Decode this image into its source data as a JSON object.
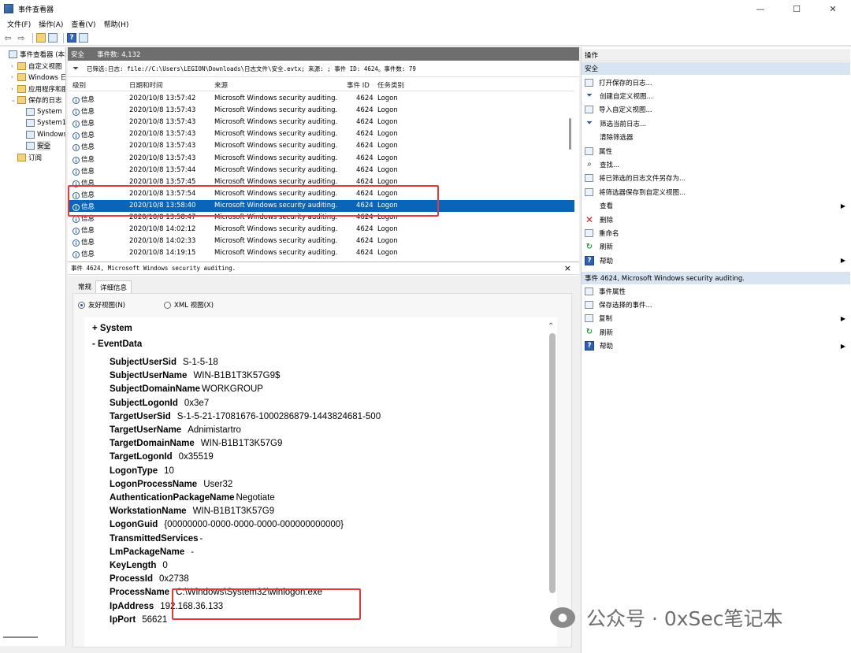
{
  "window": {
    "title": "事件查看器",
    "controls": [
      "—",
      "☐",
      "✕"
    ]
  },
  "menu": [
    "文件(F)",
    "操作(A)",
    "查看(V)",
    "帮助(H)"
  ],
  "tree": [
    {
      "label": "事件查看器 (本地)",
      "indent": 0,
      "exp": "",
      "icon": "event-viewer"
    },
    {
      "label": "自定义视图",
      "indent": 1,
      "exp": "›",
      "icon": "folder"
    },
    {
      "label": "Windows 日志",
      "indent": 1,
      "exp": "›",
      "icon": "folder"
    },
    {
      "label": "应用程序和服务日志",
      "indent": 1,
      "exp": "›",
      "icon": "folder"
    },
    {
      "label": "保存的日志",
      "indent": 1,
      "exp": "⌄",
      "icon": "folder"
    },
    {
      "label": "System",
      "indent": 2,
      "exp": "",
      "icon": "log"
    },
    {
      "label": "System1",
      "indent": 2,
      "exp": "",
      "icon": "log"
    },
    {
      "label": "Windows",
      "indent": 2,
      "exp": "",
      "icon": "log"
    },
    {
      "label": "安全",
      "indent": 2,
      "exp": "",
      "icon": "log",
      "selected": true
    },
    {
      "label": "订阅",
      "indent": 1,
      "exp": "",
      "icon": "subscription"
    }
  ],
  "center": {
    "header_name": "安全",
    "header_count": "事件数: 4,132",
    "filter_text": "已筛选:日志: file://C:\\Users\\LEGION\\Downloads\\日志文件\\安全.evtx; 来源: ; 事件 ID: 4624。事件数: 79",
    "columns": [
      "级别",
      "日期和时间",
      "来源",
      "事件 ID",
      "任务类别"
    ],
    "rows": [
      {
        "level": "信息",
        "datetime": "2020/10/8 13:57:42",
        "source": "Microsoft Windows security auditing.",
        "id": "4624",
        "task": "Logon"
      },
      {
        "level": "信息",
        "datetime": "2020/10/8 13:57:43",
        "source": "Microsoft Windows security auditing.",
        "id": "4624",
        "task": "Logon"
      },
      {
        "level": "信息",
        "datetime": "2020/10/8 13:57:43",
        "source": "Microsoft Windows security auditing.",
        "id": "4624",
        "task": "Logon"
      },
      {
        "level": "信息",
        "datetime": "2020/10/8 13:57:43",
        "source": "Microsoft Windows security auditing.",
        "id": "4624",
        "task": "Logon"
      },
      {
        "level": "信息",
        "datetime": "2020/10/8 13:57:43",
        "source": "Microsoft Windows security auditing.",
        "id": "4624",
        "task": "Logon"
      },
      {
        "level": "信息",
        "datetime": "2020/10/8 13:57:43",
        "source": "Microsoft Windows security auditing.",
        "id": "4624",
        "task": "Logon"
      },
      {
        "level": "信息",
        "datetime": "2020/10/8 13:57:44",
        "source": "Microsoft Windows security auditing.",
        "id": "4624",
        "task": "Logon"
      },
      {
        "level": "信息",
        "datetime": "2020/10/8 13:57:45",
        "source": "Microsoft Windows security auditing.",
        "id": "4624",
        "task": "Logon"
      },
      {
        "level": "信息",
        "datetime": "2020/10/8 13:57:54",
        "source": "Microsoft Windows security auditing.",
        "id": "4624",
        "task": "Logon"
      },
      {
        "level": "信息",
        "datetime": "2020/10/8 13:58:40",
        "source": "Microsoft Windows security auditing.",
        "id": "4624",
        "task": "Logon",
        "selected": true
      },
      {
        "level": "信息",
        "datetime": "2020/10/8 13:58:47",
        "source": "Microsoft Windows security auditing.",
        "id": "4624",
        "task": "Logon"
      },
      {
        "level": "信息",
        "datetime": "2020/10/8 14:02:12",
        "source": "Microsoft Windows security auditing.",
        "id": "4624",
        "task": "Logon"
      },
      {
        "level": "信息",
        "datetime": "2020/10/8 14:02:33",
        "source": "Microsoft Windows security auditing.",
        "id": "4624",
        "task": "Logon"
      },
      {
        "level": "信息",
        "datetime": "2020/10/8 14:19:15",
        "source": "Microsoft Windows security auditing.",
        "id": "4624",
        "task": "Logon"
      }
    ],
    "detail_title": "事件 4624, Microsoft Windows security auditing.",
    "tabs": [
      "常规",
      "详细信息"
    ],
    "radio_friendly": "友好视图(N)",
    "radio_xml": "XML 视图(X)",
    "xml_system": "+ System",
    "xml_eventdata": "- EventData",
    "event_data": [
      {
        "key": "SubjectUserSid",
        "value": "S-1-5-18"
      },
      {
        "key": "SubjectUserName",
        "value": "WIN-B1B1T3K57G9$"
      },
      {
        "key": "SubjectDomainName",
        "value": "WORKGROUP"
      },
      {
        "key": "SubjectLogonId",
        "value": "0x3e7"
      },
      {
        "key": "TargetUserSid",
        "value": "S-1-5-21-17081676-1000286879-1443824681-500"
      },
      {
        "key": "TargetUserName",
        "value": "Adnimistartro"
      },
      {
        "key": "TargetDomainName",
        "value": "WIN-B1B1T3K57G9"
      },
      {
        "key": "TargetLogonId",
        "value": "0x35519"
      },
      {
        "key": "LogonType",
        "value": "10"
      },
      {
        "key": "LogonProcessName",
        "value": "User32"
      },
      {
        "key": "AuthenticationPackageName",
        "value": "Negotiate"
      },
      {
        "key": "WorkstationName",
        "value": "WIN-B1B1T3K57G9"
      },
      {
        "key": "LogonGuid",
        "value": "{00000000-0000-0000-0000-000000000000}"
      },
      {
        "key": "TransmittedServices",
        "value": "-"
      },
      {
        "key": "LmPackageName",
        "value": "-"
      },
      {
        "key": "KeyLength",
        "value": "0"
      },
      {
        "key": "ProcessId",
        "value": "0x2738"
      },
      {
        "key": "ProcessName",
        "value": "C:\\Windows\\System32\\winlogon.exe"
      },
      {
        "key": "IpAddress",
        "value": "192.168.36.133"
      },
      {
        "key": "IpPort",
        "value": "56621"
      }
    ]
  },
  "actions": {
    "title": "操作",
    "section1": "安全",
    "items1": [
      {
        "label": "打开保存的日志...",
        "icon": "open-log-icon"
      },
      {
        "label": "创建自定义视图...",
        "icon": "filter-icon"
      },
      {
        "label": "导入自定义视图...",
        "icon": "import-icon"
      },
      {
        "label": "筛选当前日志...",
        "icon": "filter-icon"
      },
      {
        "label": "清除筛选器",
        "icon": "none"
      },
      {
        "label": "属性",
        "icon": "properties-icon"
      },
      {
        "label": "查找...",
        "icon": "find-icon"
      },
      {
        "label": "将已筛选的日志文件另存为...",
        "icon": "save-icon"
      },
      {
        "label": "将筛选器保存到自定义视图...",
        "icon": "save-filter-icon"
      },
      {
        "label": "查看",
        "icon": "none",
        "arrow": true
      },
      {
        "label": "删除",
        "icon": "delete-icon"
      },
      {
        "label": "重命名",
        "icon": "rename-icon"
      },
      {
        "label": "刷新",
        "icon": "refresh-icon"
      },
      {
        "label": "帮助",
        "icon": "help-icon",
        "arrow": true
      }
    ],
    "section2": "事件 4624, Microsoft Windows security auditing.",
    "items2": [
      {
        "label": "事件属性",
        "icon": "properties-icon"
      },
      {
        "label": "保存选择的事件...",
        "icon": "save-icon"
      },
      {
        "label": "复制",
        "icon": "copy-icon",
        "arrow": true
      },
      {
        "label": "刷新",
        "icon": "refresh-icon"
      },
      {
        "label": "帮助",
        "icon": "help-icon",
        "arrow": true
      }
    ]
  },
  "watermark": "公众号 · 0xSec笔记本",
  "colors": {
    "selection": "#0a64b8",
    "header": "#6e6e6e",
    "highlight_box": "#e53a3a",
    "section": "#d8e4f2"
  }
}
